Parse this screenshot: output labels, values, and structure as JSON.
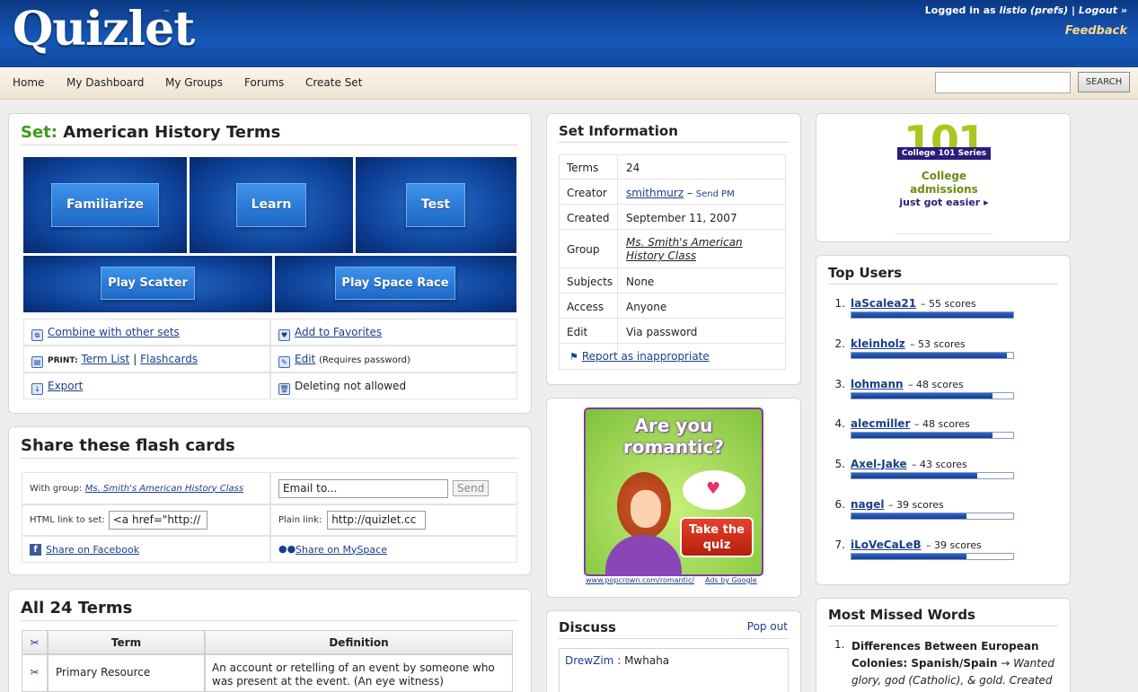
{
  "header": {
    "logo": "Quizlet",
    "tm": "™",
    "logged_in_prefix": "Logged in as",
    "username": "listio",
    "prefs": "(prefs)",
    "separator": "|",
    "logout": "Logout »",
    "feedback": "Feedback"
  },
  "nav": {
    "items": [
      "Home",
      "My Dashboard",
      "My Groups",
      "Forums",
      "Create Set"
    ],
    "search_button": "SEARCH",
    "search_value": ""
  },
  "set": {
    "label": "Set:",
    "title": "American History Terms",
    "modes": [
      "Familiarize",
      "Learn",
      "Test",
      "Play Scatter",
      "Play Space Race"
    ],
    "actions": {
      "combine": "Combine with other sets",
      "favorites": "Add to Favorites",
      "print_label": "PRINT:",
      "term_list": "Term List",
      "print_sep": "|",
      "flashcards": "Flashcards",
      "edit": "Edit",
      "edit_note": "(Requires password)",
      "export": "Export",
      "deleting": "Deleting not allowed"
    }
  },
  "share": {
    "title": "Share these flash cards",
    "with_group_label": "With group:",
    "group_link": "Ms. Smith's American History Class",
    "email_value": "Email to...",
    "send": "Send",
    "html_label": "HTML link to set:",
    "html_value": "<a href=\"http://",
    "plain_label": "Plain link:",
    "plain_value": "http://quizlet.cc",
    "facebook": "Share on Facebook",
    "myspace": "Share on MySpace"
  },
  "terms": {
    "title": "All 24 Terms",
    "col_term": "Term",
    "col_definition": "Definition",
    "rows": [
      {
        "term": "Primary Resource",
        "definition": "An account or retelling of an event by someone who was present at the event. (An eye witness)"
      }
    ]
  },
  "info": {
    "title": "Set Information",
    "rows": [
      {
        "k": "Terms",
        "v": "24"
      },
      {
        "k": "Creator",
        "v": "smithmurz",
        "extra": "Send PM"
      },
      {
        "k": "Created",
        "v": "September 11, 2007"
      },
      {
        "k": "Group",
        "v": "Ms. Smith's American History Class"
      },
      {
        "k": "Subjects",
        "v": "None"
      },
      {
        "k": "Access",
        "v": "Anyone"
      },
      {
        "k": "Edit",
        "v": "Via password"
      }
    ],
    "creator_sep": "–",
    "report": "Report as inappropriate"
  },
  "ad": {
    "headline1": "Are you",
    "headline2": "romantic?",
    "cta1": "Take the",
    "cta2": "quiz",
    "url": "www.popcrown.com/romantic/",
    "ads_by": "Ads by Google"
  },
  "discuss": {
    "title": "Discuss",
    "popout": "Pop out",
    "user": "DrewZim",
    "sep": ":",
    "message": "Mwhaha"
  },
  "promo": {
    "big": "101",
    "series": "College 101 Series",
    "line1": "College",
    "line2": "admissions",
    "line3": "just got easier"
  },
  "top_users": {
    "title": "Top Users",
    "users": [
      {
        "rank": "1.",
        "name": "laScalea21",
        "scores": "55 scores",
        "pct": 100
      },
      {
        "rank": "2.",
        "name": "kleinholz",
        "scores": "53 scores",
        "pct": 96
      },
      {
        "rank": "3.",
        "name": "lohmann",
        "scores": "48 scores",
        "pct": 87
      },
      {
        "rank": "4.",
        "name": "alecmiller",
        "scores": "48 scores",
        "pct": 87
      },
      {
        "rank": "5.",
        "name": "Axel-Jake",
        "scores": "43 scores",
        "pct": 78
      },
      {
        "rank": "6.",
        "name": "nagel",
        "scores": "39 scores",
        "pct": 71
      },
      {
        "rank": "7.",
        "name": "iLoVeCaLeB",
        "scores": "39 scores",
        "pct": 71
      }
    ],
    "sep": "–"
  },
  "missed": {
    "title": "Most Missed Words",
    "rank": "1.",
    "term": "Differences Between European Colonies: Spanish/Spain",
    "arrow": "→",
    "definition": "Wanted glory, god (Catholic), & gold. Created"
  },
  "colors": {
    "header_blue": "#0c3a86",
    "link": "#1a3e8c",
    "set_green": "#3b9b1a",
    "feedback": "#ffd987"
  }
}
